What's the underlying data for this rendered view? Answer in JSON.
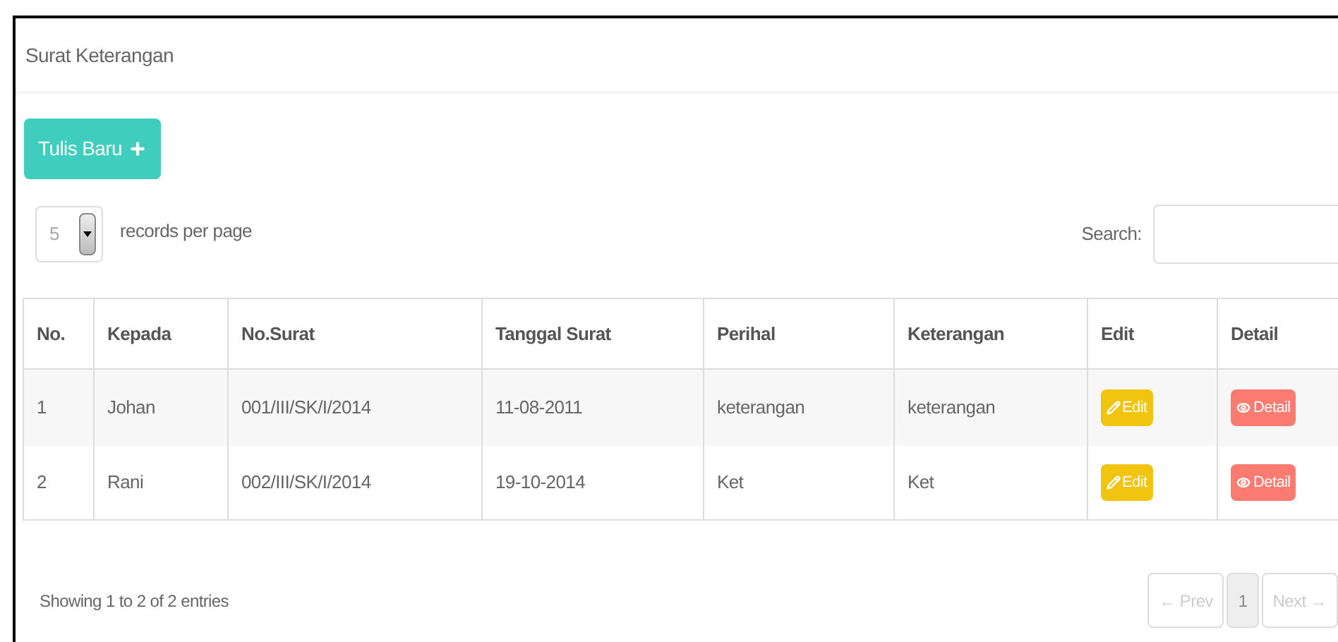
{
  "panel": {
    "title": "Surat Keterangan"
  },
  "new_button": {
    "label": "Tulis Baru"
  },
  "page_size": {
    "value": "5",
    "label": "records per page"
  },
  "search": {
    "label": "Search:"
  },
  "table": {
    "columns": [
      "No.",
      "Kepada",
      "No.Surat",
      "Tanggal Surat",
      "Perihal",
      "Keterangan",
      "Edit",
      "Detail"
    ],
    "rows": [
      {
        "cells": [
          "1",
          "Johan",
          "001/III/SK/I/2014",
          "11-08-2011",
          "keterangan",
          "keterangan"
        ],
        "edit": "Edit",
        "detail": "Detail"
      },
      {
        "cells": [
          "2",
          "Rani",
          "002/III/SK/I/2014",
          "19-10-2014",
          "Ket",
          "Ket"
        ],
        "edit": "Edit",
        "detail": "Detail"
      }
    ]
  },
  "footer": {
    "info": "Showing 1 to 2 of 2 entries"
  },
  "pagination": [
    {
      "label": "← Prev",
      "selected": false,
      "disabled": true
    },
    {
      "label": "1",
      "selected": true,
      "disabled": false
    },
    {
      "label": "Next →",
      "selected": false,
      "disabled": true
    }
  ]
}
